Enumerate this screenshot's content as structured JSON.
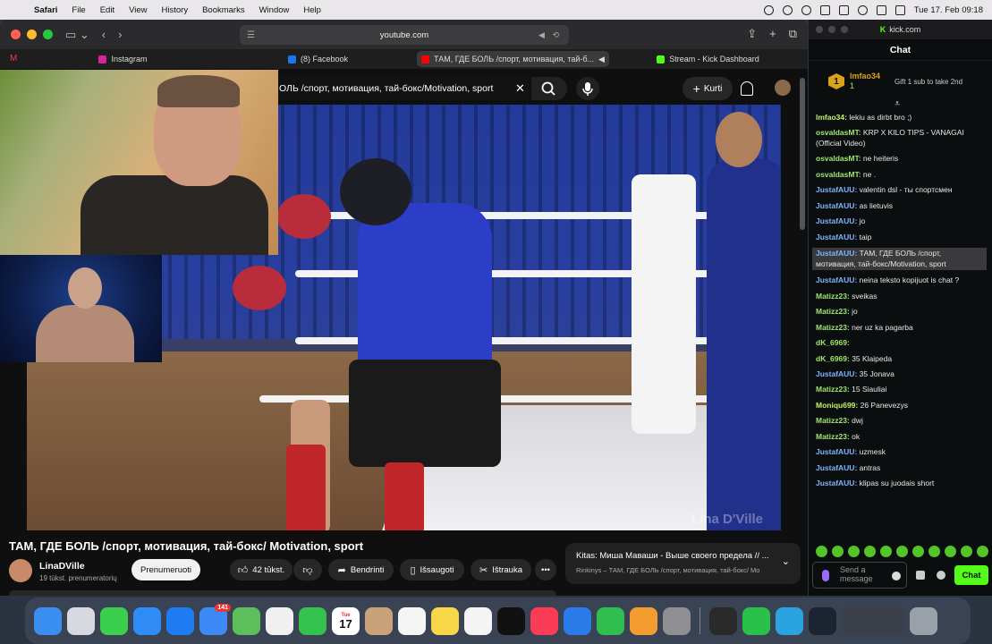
{
  "menubar": {
    "app": "Safari",
    "items": [
      "File",
      "Edit",
      "View",
      "History",
      "Bookmarks",
      "Window",
      "Help"
    ],
    "clock": "Tue 17. Feb  09:18"
  },
  "safari": {
    "url": "youtube.com",
    "tabs": [
      {
        "label": "Instagram",
        "color": "#d6249f"
      },
      {
        "label": "(8) Facebook",
        "color": "#1877f2"
      },
      {
        "label": "ТАМ, ГДЕ БОЛЬ /спорт, мотивация, тай-б...",
        "color": "#ff0000"
      },
      {
        "label": "Stream - Kick Dashboard",
        "color": "#53fc18"
      }
    ]
  },
  "youtube": {
    "search_value": "ОЛЬ /спорт, мотивация, тай-бокс/Motivation, sport",
    "create_label": "Kurti",
    "video_title": "ТАМ, ГДЕ БОЛЬ /спорт, мотивация, тай-бокс/ Motivation, sport",
    "watermark": "Lina D'Ville",
    "channel_name": "LinaDVille",
    "channel_subs": "19 tūkst. prenumeratorių",
    "subscribe_label": "Prenumeruoti",
    "like_count": "42 tūkst.",
    "share_label": "Bendrinti",
    "save_label": "Išsaugoti",
    "clip_label": "Ištrauka",
    "next_title": "Kitas: Миша Маваши - Выше своего предела // ...",
    "next_playlist": "Rinkinys – ТАМ, ГДЕ БОЛЬ /спорт, мотивация, тай-бокс/ Mo"
  },
  "kick": {
    "url": "kick.com",
    "header": "Chat",
    "top_gifter": {
      "rank": "1",
      "name": "lmfao34",
      "count": "1",
      "gift_text": "Gift 1 sub to take 2nd"
    },
    "messages": [
      {
        "user": "lmfao34:",
        "text": "lekiu as dirbt bro ;)",
        "cls": "lime"
      },
      {
        "user": "osvaldasMT:",
        "text": "KRP X KILO TIPS - VANAGAI (Official Video)",
        "cls": "green"
      },
      {
        "user": "osvaldasMT:",
        "text": "ne heiteris",
        "cls": "green"
      },
      {
        "user": "osvaldasMT:",
        "text": "ne .",
        "cls": "green"
      },
      {
        "user": "JustafAUU:",
        "text": "valentin dsl - ты спортсмен",
        "cls": "blue"
      },
      {
        "user": "JustafAUU:",
        "text": "as lietuvis",
        "cls": "blue"
      },
      {
        "user": "JustafAUU:",
        "text": "jo",
        "cls": "blue"
      },
      {
        "user": "JustafAUU:",
        "text": "taip",
        "cls": "blue"
      },
      {
        "user": "JustafAUU:",
        "text": "ТАМ, ГДЕ БОЛЬ /спорт, мотивация, тай-бокс/Motivation, sport",
        "cls": "blue",
        "hl": true
      },
      {
        "user": "JustafAUU:",
        "text": "neina teksto kopijuot is chat ?",
        "cls": "blue"
      },
      {
        "user": "Matizz23:",
        "text": "sveikas",
        "cls": "green"
      },
      {
        "user": "Matizz23:",
        "text": "jo",
        "cls": "green"
      },
      {
        "user": "Matizz23:",
        "text": "ner uz ka pagarba",
        "cls": "green"
      },
      {
        "user": "dK_6969:",
        "text": "",
        "cls": "green"
      },
      {
        "user": "dK_6969:",
        "text": "35 Klaipeda",
        "cls": "green"
      },
      {
        "user": "JustafAUU:",
        "text": "35 Jonava",
        "cls": "blue"
      },
      {
        "user": "Matizz23:",
        "text": "15 Siauliai",
        "cls": "green"
      },
      {
        "user": "Moniqu699:",
        "text": "26 Panevezys",
        "cls": "lime"
      },
      {
        "user": "Matizz23:",
        "text": "dwj",
        "cls": "green"
      },
      {
        "user": "Matizz23:",
        "text": "ok",
        "cls": "green"
      },
      {
        "user": "JustafAUU:",
        "text": "uzmesk",
        "cls": "blue"
      },
      {
        "user": "JustafAUU:",
        "text": "antras",
        "cls": "blue"
      },
      {
        "user": "JustafAUU:",
        "text": "klipas su juodais short",
        "cls": "blue"
      }
    ],
    "input_placeholder": "Send a message",
    "send_label": "Chat"
  },
  "dock": {
    "calendar_month": "Tue",
    "calendar_day": "17",
    "mail_badge": "141",
    "apps": [
      {
        "name": "finder-icon",
        "color": "#3a8ef0"
      },
      {
        "name": "launchpad-icon",
        "color": "#d8d8e0"
      },
      {
        "name": "messages-icon",
        "color": "#3ccf4e"
      },
      {
        "name": "safari-icon",
        "color": "#2f8cf5"
      },
      {
        "name": "app-store-icon",
        "color": "#1e7cf2"
      },
      {
        "name": "mail-icon",
        "color": "#3d8af7"
      },
      {
        "name": "maps-icon",
        "color": "#5cbf5c"
      },
      {
        "name": "photos-icon",
        "color": "#f0f0f0"
      },
      {
        "name": "facetime-icon",
        "color": "#33c24d"
      },
      {
        "name": "calendar-icon",
        "color": "#ffffff"
      },
      {
        "name": "contacts-icon",
        "color": "#c9a27a"
      },
      {
        "name": "reminders-icon",
        "color": "#f5f5f5"
      },
      {
        "name": "notes-icon",
        "color": "#f7d64a"
      },
      {
        "name": "freeform-icon",
        "color": "#f4f4f4"
      },
      {
        "name": "apple-tv-icon",
        "color": "#111111"
      },
      {
        "name": "music-icon",
        "color": "#fa3c56"
      },
      {
        "name": "keynote-icon",
        "color": "#2a7be8"
      },
      {
        "name": "numbers-icon",
        "color": "#2fbe4f"
      },
      {
        "name": "pages-icon",
        "color": "#f39c2f"
      },
      {
        "name": "system-settings-icon",
        "color": "#8e8e93"
      },
      {
        "name": "obs-icon",
        "color": "#2a2a2a"
      },
      {
        "name": "whatsapp-icon",
        "color": "#29c14a"
      },
      {
        "name": "telegram-icon",
        "color": "#2aa3e0"
      },
      {
        "name": "league-icon",
        "color": "#1b2430"
      }
    ]
  }
}
